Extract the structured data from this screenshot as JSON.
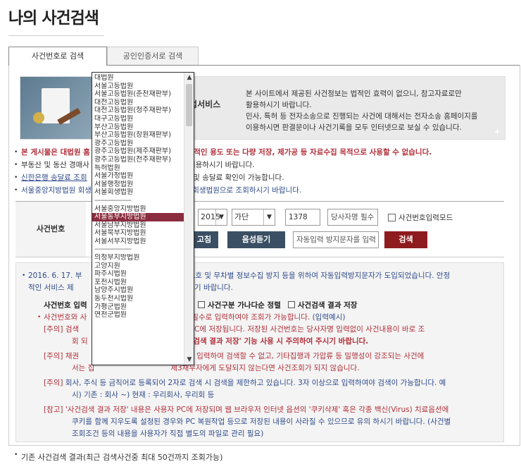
{
  "page": {
    "title": "나의 사건검색"
  },
  "tabs": [
    {
      "label": "사건번호로 검색"
    },
    {
      "label": "공인인증서로 검색"
    }
  ],
  "banner": {
    "heading": "사법서비스",
    "desc_1": "본 사이트에서 제공된 사건정보는 법적인 효력이 없으니, 참고자료로만",
    "desc_2": "활용하시기 바랍니다.",
    "desc_3": "민사, 특허 등 전자소송으로 진행되는 사건에 대해서는 전자소송 홈페이지를",
    "desc_4": "이용하시면 판결문이나 사건기록을 모두 인터넷으로 보실 수 있습니다.",
    "corner": "+"
  },
  "notices": [
    {
      "prefix": "본 게시물은 대법원 홈",
      "rest": "상업적인 용도 또는 다량 저장, 제가공 등 자료수집 목적으로 사용할 수 없습니다."
    },
    {
      "prefix": "부동산 및 동산 경매사",
      "rest": "를 이용하시기 바랍니다."
    },
    {
      "prefix": "신한은행 송달료 조회",
      "rest": "번호 및 송달료 확인이 가능합니다."
    },
    {
      "prefix": "서울중앙지방법원 회생",
      "rest": "서울회생법원으로 조회하시기 바랍니다."
    }
  ],
  "search": {
    "label": "사건번호",
    "year_value": "2015",
    "type_value": "가단",
    "number_value": "1378",
    "party_placeholder": "당사자명 필수",
    "case_mode_label": "사건번호입력모드",
    "image_btn": "고침",
    "audio_btn": "음성듣기",
    "captcha_placeholder": "자동입력 방지문자를 입력",
    "search_btn": "검색"
  },
  "info": {
    "l1a": "2016. 6. 17. 부",
    "l1b": "정보보호 및 무차별 정보수집 방지 등을 위하여 자동입력방지문자가 도입되었습니다. 안정",
    "l2a": "적인 서비스 제",
    "l2b": "해 주시기 바랍니다.",
    "l3a": "사건번호 입력",
    "l3b": "정렬",
    "l3c": "사건구분 가나다순 정렬",
    "l3d": "사건검색 결과 저장",
    "l4a": "사건번호와 사",
    "l4b": "상 필수로 입력하여야 조회가 가능합니다.",
    "l4c": "(입력예시)",
    "l5tag": "[주의]",
    "l5a": "검색",
    "l5b": "장' 체크 시 PC에 저장됩니다. 저장된 사건번호는 당사자명 입력없이 사건내용이 바로 조",
    "l6a": "회 되",
    "l6b": "건검색 결과 저장' 기능 사용 시 주의하여 주시기 바랍니다.",
    "l7tag": "[주의]",
    "l7a": "채권",
    "l7b": "채무자 명을 입력하여 검색할 수 없고, 기타집행과 가압류 등 밀행성이 강조되는 사건에",
    "l8a": "서는 집",
    "l8b": "제3채무자에게 도달되지 않는다면 사건조회가 되지 않습니다.",
    "l9tag": "[주의]",
    "l9a": "회사, 주식 등 금칙어로 등록되어 2자로 검색 시 검색을 제한하고 있습니다. 3자 이상으로 입력하여야 검색이 가능합니다. 예",
    "l10a": "시) 기존 : 회사 ~) 현재 : 우리회사, 우리회 등",
    "l11tag": "[참고]",
    "l11a": "'사건검색 결과 저장' 내용은 사용자 PC에 저장되며 웹 브라우저 인터넷 옵션의 '쿠키삭제' 혹은 각종 백신(Virus) 치료옵션에",
    "l12a": "쿠키를 함께 지우도록 설정된 경우와 PC 복원작업 등으로 저장된 내용이 사라질 수 있으므로 유의 하시기 바랍니다. (사건별",
    "l13a": "조회조건 등의 내용을 사용자가 직접 별도의 파일로 관리 필요)"
  },
  "bottom_note": "기존 사건검색 결과(최근 검색사건중 최대 50건까지 조회가능)",
  "dropdown": {
    "selected_index": 17,
    "items": [
      "대법원",
      "서울고등법원",
      "서울고등법원(춘천재판부)",
      "대전고등법원",
      "대전고등법원(청주재판부)",
      "대구고등법원",
      "부산고등법원",
      "부산고등법원(창원재판부)",
      "광주고등법원",
      "광주고등법원(제주재판부)",
      "광주고등법원(전주재판부)",
      "특허법원",
      "서울가정법원",
      "서울행정법원",
      "서울회생법원",
      "--------------------",
      "서울중앙지방법원",
      "서울동부지방법원",
      "서울남부지방법원",
      "서울북부지방법원",
      "서울서부지방법원",
      "--------------------",
      "의정부지방법원",
      "고양지원",
      "파주시법원",
      "포천시법원",
      "남양주시법원",
      "동두천시법원",
      "가평군법원",
      "연천군법원"
    ]
  }
}
